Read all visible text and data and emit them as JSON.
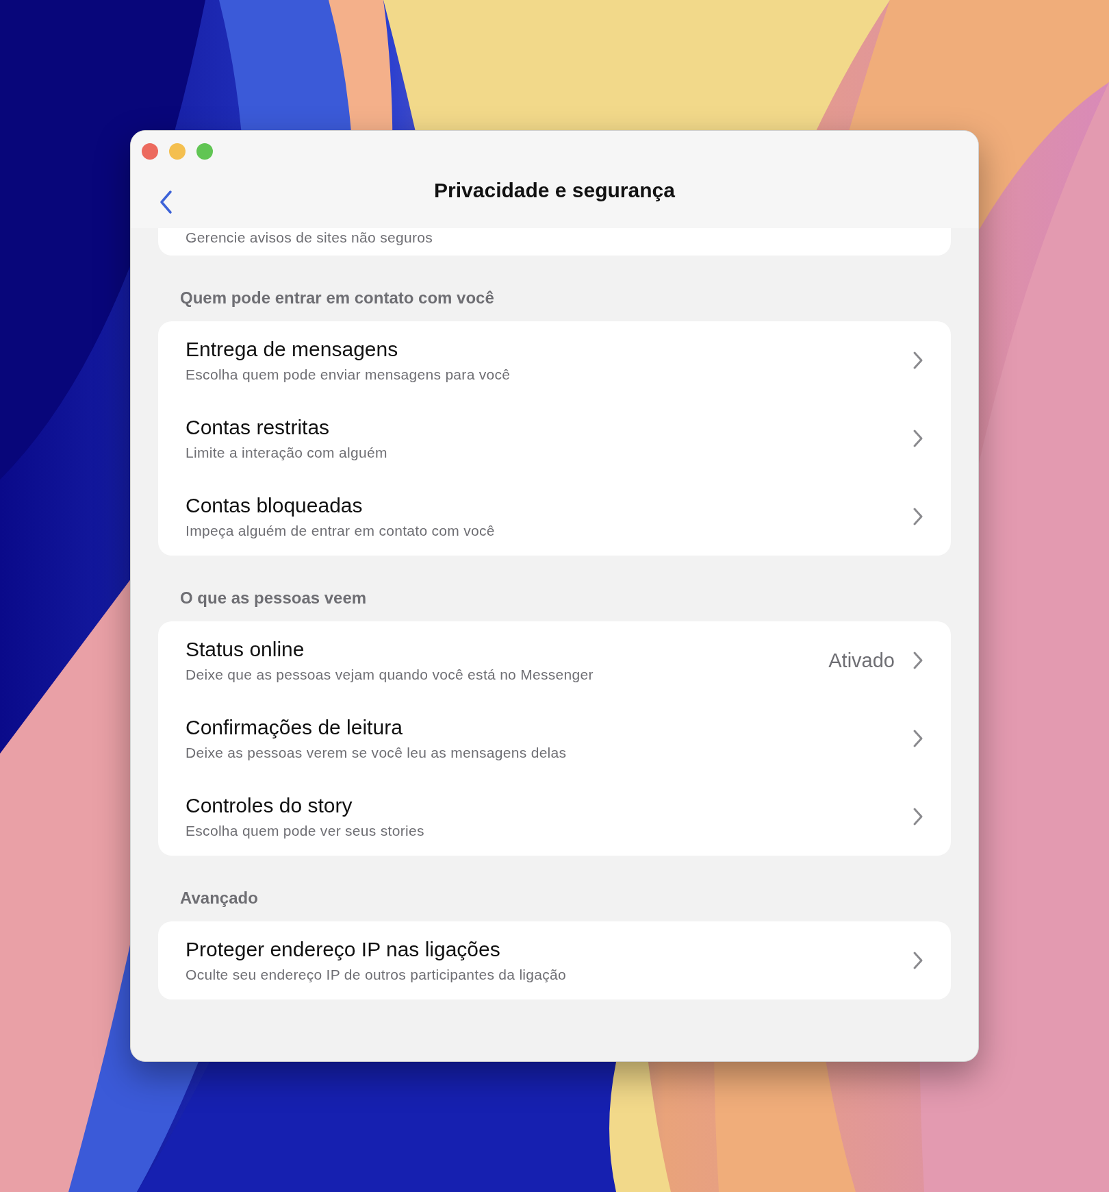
{
  "window": {
    "title": "Privacidade e segurança"
  },
  "top_card": {
    "subtitle": "Gerencie avisos de sites não seguros"
  },
  "sections": [
    {
      "header": "Quem pode entrar em contato com você",
      "rows": [
        {
          "title": "Entrega de mensagens",
          "subtitle": "Escolha quem pode enviar mensagens para você"
        },
        {
          "title": "Contas restritas",
          "subtitle": "Limite a interação com alguém"
        },
        {
          "title": "Contas bloqueadas",
          "subtitle": "Impeça alguém de entrar em contato com você"
        }
      ]
    },
    {
      "header": "O que as pessoas veem",
      "rows": [
        {
          "title": "Status online",
          "subtitle": "Deixe que as pessoas vejam quando você está no Messenger",
          "value": "Ativado"
        },
        {
          "title": "Confirmações de leitura",
          "subtitle": "Deixe as pessoas verem se você leu as mensagens delas"
        },
        {
          "title": "Controles do story",
          "subtitle": "Escolha quem pode ver seus stories"
        }
      ]
    },
    {
      "header": "Avançado",
      "rows": [
        {
          "title": "Proteger endereço IP nas ligações",
          "subtitle": "Oculte seu endereço IP de outros participantes da ligação"
        }
      ]
    }
  ]
}
